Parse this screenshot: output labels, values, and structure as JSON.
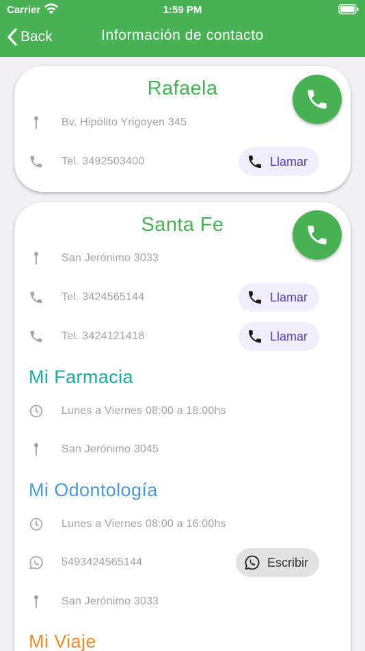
{
  "status_bar": {
    "carrier": "Carrier",
    "time": "1:59 PM"
  },
  "nav": {
    "back_label": "Back",
    "title": "Información de contacto"
  },
  "colors": {
    "primary": "#47b153",
    "call_text": "#5b3db5",
    "farmacia": "#19a89a",
    "odontologia": "#4a97d6",
    "viaje": "#ef8a28"
  },
  "rafaela": {
    "title": "Rafaela",
    "address": "Bv. Hipólito Yrigoyen 345",
    "phone": "Tel. 3492503400",
    "call_label": "Llamar"
  },
  "santa_fe": {
    "title": "Santa Fe",
    "address": "San Jerónimo 3033",
    "phone_1": "Tel. 3424565144",
    "phone_2": "Tel. 3424121418",
    "call_label": "Llamar"
  },
  "farmacia": {
    "title": "Mi Farmacia",
    "hours": "Lunes a Viernes 08:00 a 18:00hs",
    "address": "San Jerónimo 3045"
  },
  "odontologia": {
    "title": "Mi Odontología",
    "hours": "Lunes a Viernes 08:00 a 16:00hs",
    "whatsapp": "5493424565144",
    "write_label": "Escribir",
    "address": "San Jerónimo 3033"
  },
  "viaje": {
    "title": "Mi Viaje"
  }
}
